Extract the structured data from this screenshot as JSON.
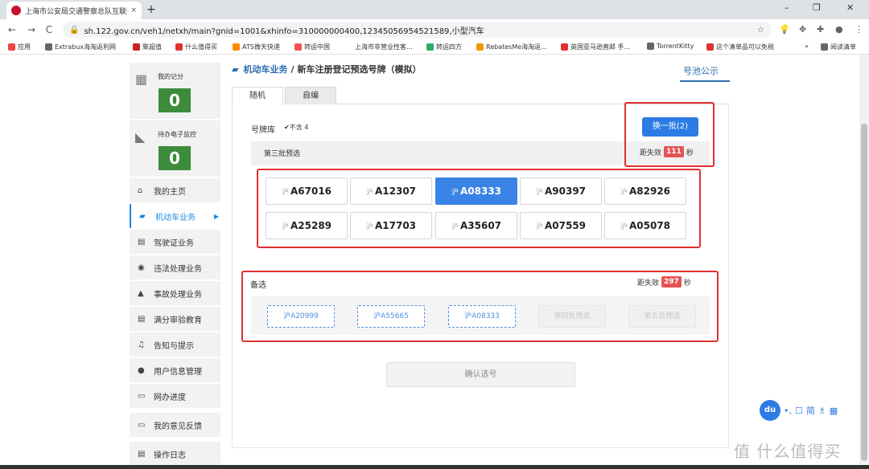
{
  "browser": {
    "tab_title": "上海市公安局交通警察总队互联网",
    "tab_close": "×",
    "new_tab": "+",
    "url": "sh.122.gov.cn/veh1/netxh/main?gnid=1001&xhinfo=310000000400,12345056954521589,小型汽车",
    "win_minimize": "–",
    "win_restore": "❐",
    "win_close": "✕",
    "back": "←",
    "forward": "→",
    "reload": "C",
    "home": "⌂",
    "lock": "🔒",
    "star": "☆",
    "menu": "⋮"
  },
  "bookmarks": [
    {
      "label": "应用",
      "color": "#e44"
    },
    {
      "label": "Extrabux海淘返利网",
      "color": "#666"
    },
    {
      "label": "聚超值",
      "color": "#c22"
    },
    {
      "label": "什么值得买",
      "color": "#d33"
    },
    {
      "label": "ATS微天快递",
      "color": "#f80"
    },
    {
      "label": "转运中国",
      "color": "#e55"
    },
    {
      "label": "上海市非营业性客...",
      "color": "#fff"
    },
    {
      "label": "转运四方",
      "color": "#3a6"
    },
    {
      "label": "RebatesMe海淘返...",
      "color": "#e90"
    },
    {
      "label": "英国亚马逊直邮 手...",
      "color": "#d33"
    },
    {
      "label": "TorrentKitty",
      "color": "#666"
    },
    {
      "label": "这个凑单品可以免税",
      "color": "#d33"
    },
    {
      "label": "»",
      "color": "#fff"
    },
    {
      "label": "阅读清单",
      "color": "#666"
    }
  ],
  "sidebar": {
    "score_label": "我的记分",
    "score_value": "0",
    "monitor_label": "待办电子监控",
    "monitor_value": "0",
    "items": [
      {
        "label": "我的主页",
        "icon": "home-icon",
        "glyph": "⌂"
      },
      {
        "label": "机动车业务",
        "icon": "truck-icon",
        "glyph": "▰"
      },
      {
        "label": "驾驶证业务",
        "icon": "card-icon",
        "glyph": "▤"
      },
      {
        "label": "违法处理业务",
        "icon": "camera-icon",
        "glyph": "◉"
      },
      {
        "label": "事故处理业务",
        "icon": "warning-icon",
        "glyph": "▲"
      },
      {
        "label": "满分审验教育",
        "icon": "card-icon",
        "glyph": "▤"
      },
      {
        "label": "告知与提示",
        "icon": "bell-icon",
        "glyph": "♫"
      },
      {
        "label": "用户信息管理",
        "icon": "user-icon",
        "glyph": "●"
      },
      {
        "label": "网办进度",
        "icon": "progress-icon",
        "glyph": "▭"
      },
      {
        "label": "我的意见反馈",
        "icon": "feedback-icon",
        "glyph": "▭"
      },
      {
        "label": "操作日志",
        "icon": "log-icon",
        "glyph": "▤"
      }
    ],
    "active_index": 1
  },
  "header": {
    "section": "机动车业务",
    "sep": "/",
    "title": "新车注册登记预选号牌（模拟）",
    "pool_link": "号池公示"
  },
  "tabs": [
    {
      "label": "随机",
      "selected": true
    },
    {
      "label": "自编",
      "selected": false
    }
  ],
  "plate_library": {
    "label": "号牌库",
    "exclude_label": "✔不含 4",
    "swap_button": "换一批(2)",
    "batch_label": "第三批预选",
    "countdown_prefix": "距失效",
    "countdown_value": "111",
    "countdown_unit": "秒",
    "prefix": "沪",
    "plates": [
      "A67016",
      "A12307",
      "A08333",
      "A90397",
      "A82926",
      "A25289",
      "A17703",
      "A35607",
      "A07559",
      "A05078"
    ],
    "selected_index": 2
  },
  "alternates": {
    "label": "备选",
    "countdown_prefix": "距失效",
    "countdown_value": "297",
    "countdown_unit": "秒",
    "items": [
      "沪A20999",
      "沪A55665",
      "沪A08333",
      "第四批预选",
      "第五批预选"
    ]
  },
  "confirm_button": "确认选号",
  "float_widget": {
    "logo": "du",
    "items": [
      "•,",
      "☐",
      "简",
      "♗",
      "▦"
    ]
  },
  "watermark": "值 什么值得买",
  "colors": {
    "primary": "#2d7be5",
    "alert": "#e55353",
    "highlight": "#e03030",
    "green": "#3c8c3c"
  }
}
